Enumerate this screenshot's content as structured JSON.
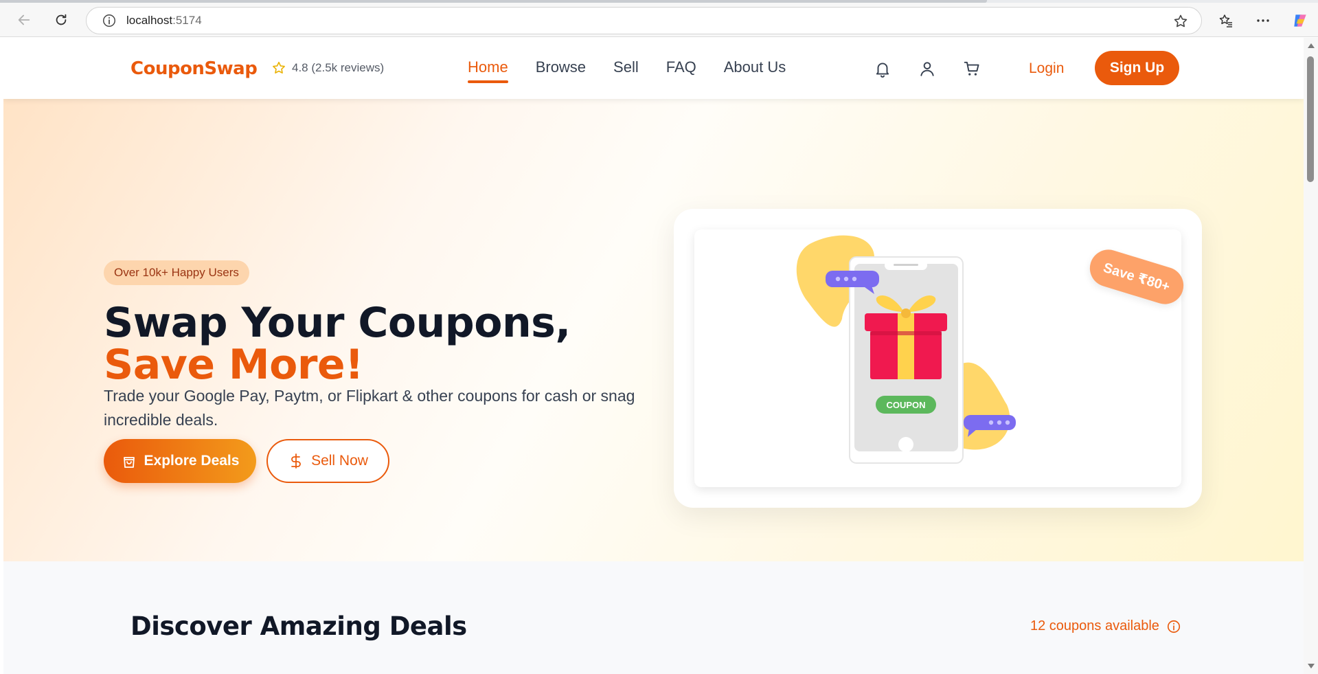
{
  "browser": {
    "url_host": "localhost",
    "url_port": ":5174"
  },
  "header": {
    "logo": "CouponSwap",
    "rating": "4.8 (2.5k reviews)",
    "nav": [
      {
        "label": "Home"
      },
      {
        "label": "Browse"
      },
      {
        "label": "Sell"
      },
      {
        "label": "FAQ"
      },
      {
        "label": "About Us"
      }
    ],
    "login": "Login",
    "signup": "Sign Up",
    "accent_color": "#ea5a0c"
  },
  "hero": {
    "badge": "Over 10k+ Happy Users",
    "title_main": "Swap Your Coupons, ",
    "title_accent": "Save More!",
    "subtitle": "Trade your Google Pay, Paytm, or Flipkart & other coupons for cash or snag incredible deals.",
    "explore_button": "Explore Deals",
    "sell_button": "Sell Now",
    "save_tag": "Save ₹80+",
    "coupon_label": "COUPON"
  },
  "deals": {
    "title": "Discover Amazing Deals",
    "count_text": "12 coupons available"
  }
}
